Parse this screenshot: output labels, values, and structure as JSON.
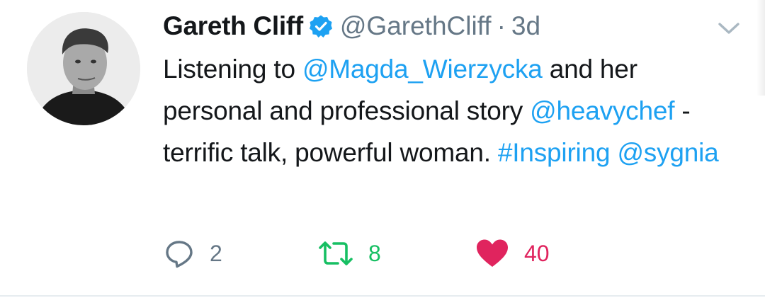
{
  "tweet": {
    "author_name": "Gareth Cliff",
    "author_handle": "@GarethCliff",
    "separator": "·",
    "time": "3d",
    "verified": true,
    "text": {
      "t1": "Listening to ",
      "mention1": "@Magda_Wierzycka",
      "t2": " and her personal and professional story ",
      "mention2": "@heavychef",
      "t3": " - terrific talk, powerful woman. ",
      "hashtag": "#Inspiring",
      "t4": " ",
      "mention3": "@sygnia"
    }
  },
  "actions": {
    "reply_count": "2",
    "retweet_count": "8",
    "like_count": "40"
  },
  "icons": {
    "avatar": "profile-photo",
    "verified": "verified-badge-icon",
    "menu": "chevron-down-icon",
    "reply": "reply-icon",
    "retweet": "retweet-icon",
    "like": "heart-icon"
  },
  "colors": {
    "link": "#1da1f2",
    "secondary_text": "#657786",
    "retweet_green": "#17bf63",
    "like_red": "#e0245e"
  }
}
